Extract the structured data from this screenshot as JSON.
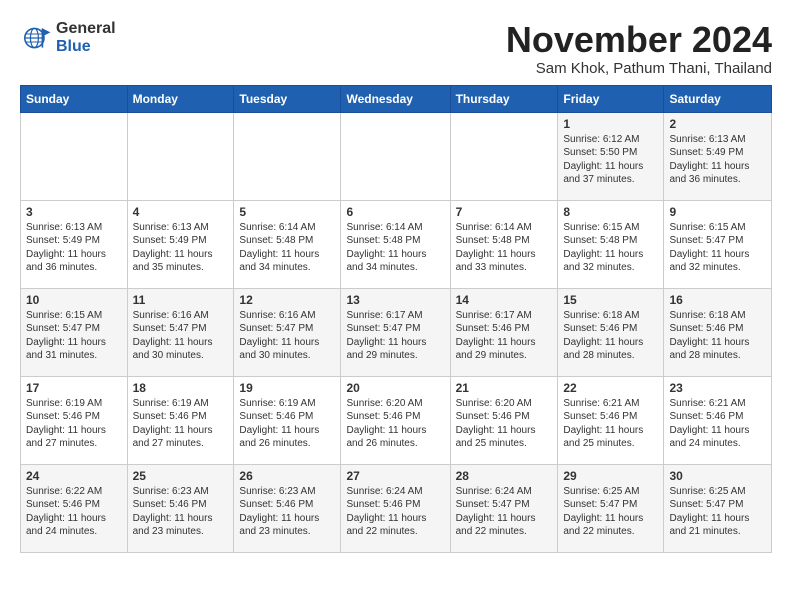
{
  "logo": {
    "general": "General",
    "blue": "Blue"
  },
  "title": "November 2024",
  "subtitle": "Sam Khok, Pathum Thani, Thailand",
  "days_of_week": [
    "Sunday",
    "Monday",
    "Tuesday",
    "Wednesday",
    "Thursday",
    "Friday",
    "Saturday"
  ],
  "weeks": [
    [
      {
        "day": "",
        "info": ""
      },
      {
        "day": "",
        "info": ""
      },
      {
        "day": "",
        "info": ""
      },
      {
        "day": "",
        "info": ""
      },
      {
        "day": "",
        "info": ""
      },
      {
        "day": "1",
        "info": "Sunrise: 6:12 AM\nSunset: 5:50 PM\nDaylight: 11 hours and 37 minutes."
      },
      {
        "day": "2",
        "info": "Sunrise: 6:13 AM\nSunset: 5:49 PM\nDaylight: 11 hours and 36 minutes."
      }
    ],
    [
      {
        "day": "3",
        "info": "Sunrise: 6:13 AM\nSunset: 5:49 PM\nDaylight: 11 hours and 36 minutes."
      },
      {
        "day": "4",
        "info": "Sunrise: 6:13 AM\nSunset: 5:49 PM\nDaylight: 11 hours and 35 minutes."
      },
      {
        "day": "5",
        "info": "Sunrise: 6:14 AM\nSunset: 5:48 PM\nDaylight: 11 hours and 34 minutes."
      },
      {
        "day": "6",
        "info": "Sunrise: 6:14 AM\nSunset: 5:48 PM\nDaylight: 11 hours and 34 minutes."
      },
      {
        "day": "7",
        "info": "Sunrise: 6:14 AM\nSunset: 5:48 PM\nDaylight: 11 hours and 33 minutes."
      },
      {
        "day": "8",
        "info": "Sunrise: 6:15 AM\nSunset: 5:48 PM\nDaylight: 11 hours and 32 minutes."
      },
      {
        "day": "9",
        "info": "Sunrise: 6:15 AM\nSunset: 5:47 PM\nDaylight: 11 hours and 32 minutes."
      }
    ],
    [
      {
        "day": "10",
        "info": "Sunrise: 6:15 AM\nSunset: 5:47 PM\nDaylight: 11 hours and 31 minutes."
      },
      {
        "day": "11",
        "info": "Sunrise: 6:16 AM\nSunset: 5:47 PM\nDaylight: 11 hours and 30 minutes."
      },
      {
        "day": "12",
        "info": "Sunrise: 6:16 AM\nSunset: 5:47 PM\nDaylight: 11 hours and 30 minutes."
      },
      {
        "day": "13",
        "info": "Sunrise: 6:17 AM\nSunset: 5:47 PM\nDaylight: 11 hours and 29 minutes."
      },
      {
        "day": "14",
        "info": "Sunrise: 6:17 AM\nSunset: 5:46 PM\nDaylight: 11 hours and 29 minutes."
      },
      {
        "day": "15",
        "info": "Sunrise: 6:18 AM\nSunset: 5:46 PM\nDaylight: 11 hours and 28 minutes."
      },
      {
        "day": "16",
        "info": "Sunrise: 6:18 AM\nSunset: 5:46 PM\nDaylight: 11 hours and 28 minutes."
      }
    ],
    [
      {
        "day": "17",
        "info": "Sunrise: 6:19 AM\nSunset: 5:46 PM\nDaylight: 11 hours and 27 minutes."
      },
      {
        "day": "18",
        "info": "Sunrise: 6:19 AM\nSunset: 5:46 PM\nDaylight: 11 hours and 27 minutes."
      },
      {
        "day": "19",
        "info": "Sunrise: 6:19 AM\nSunset: 5:46 PM\nDaylight: 11 hours and 26 minutes."
      },
      {
        "day": "20",
        "info": "Sunrise: 6:20 AM\nSunset: 5:46 PM\nDaylight: 11 hours and 26 minutes."
      },
      {
        "day": "21",
        "info": "Sunrise: 6:20 AM\nSunset: 5:46 PM\nDaylight: 11 hours and 25 minutes."
      },
      {
        "day": "22",
        "info": "Sunrise: 6:21 AM\nSunset: 5:46 PM\nDaylight: 11 hours and 25 minutes."
      },
      {
        "day": "23",
        "info": "Sunrise: 6:21 AM\nSunset: 5:46 PM\nDaylight: 11 hours and 24 minutes."
      }
    ],
    [
      {
        "day": "24",
        "info": "Sunrise: 6:22 AM\nSunset: 5:46 PM\nDaylight: 11 hours and 24 minutes."
      },
      {
        "day": "25",
        "info": "Sunrise: 6:23 AM\nSunset: 5:46 PM\nDaylight: 11 hours and 23 minutes."
      },
      {
        "day": "26",
        "info": "Sunrise: 6:23 AM\nSunset: 5:46 PM\nDaylight: 11 hours and 23 minutes."
      },
      {
        "day": "27",
        "info": "Sunrise: 6:24 AM\nSunset: 5:46 PM\nDaylight: 11 hours and 22 minutes."
      },
      {
        "day": "28",
        "info": "Sunrise: 6:24 AM\nSunset: 5:47 PM\nDaylight: 11 hours and 22 minutes."
      },
      {
        "day": "29",
        "info": "Sunrise: 6:25 AM\nSunset: 5:47 PM\nDaylight: 11 hours and 22 minutes."
      },
      {
        "day": "30",
        "info": "Sunrise: 6:25 AM\nSunset: 5:47 PM\nDaylight: 11 hours and 21 minutes."
      }
    ]
  ]
}
